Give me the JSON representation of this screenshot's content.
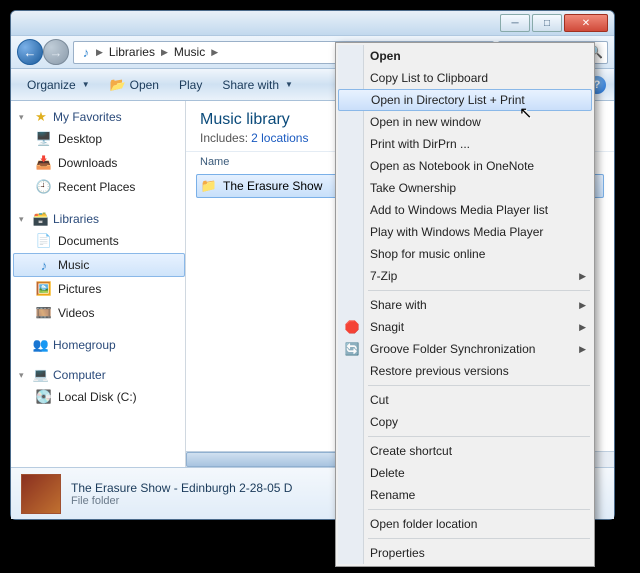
{
  "breadcrumb": {
    "icon": "♪",
    "parts": [
      "Libraries",
      "Music"
    ]
  },
  "toolbar": {
    "organize": "Organize",
    "open": "Open",
    "play": "Play",
    "share": "Share with"
  },
  "sidebar": {
    "favorites": {
      "label": "My Favorites",
      "items": [
        "Desktop",
        "Downloads",
        "Recent Places"
      ]
    },
    "libraries": {
      "label": "Libraries",
      "items": [
        "Documents",
        "Music",
        "Pictures",
        "Videos"
      ],
      "selected": 1
    },
    "homegroup": {
      "label": "Homegroup"
    },
    "computer": {
      "label": "Computer",
      "items": [
        "Local Disk (C:)"
      ]
    }
  },
  "main": {
    "title": "Music library",
    "subtitle_prefix": "Includes:",
    "subtitle_link": "2 locations",
    "col_name": "Name",
    "files": [
      {
        "name": "The Erasure Show",
        "selected": true
      }
    ]
  },
  "details": {
    "title": "The Erasure Show - Edinburgh 2-28-05  D",
    "type": "File folder"
  },
  "context_menu": [
    {
      "label": "Open",
      "bold": true
    },
    {
      "label": "Copy List to Clipboard"
    },
    {
      "label": "Open in Directory List + Print",
      "highlight": true
    },
    {
      "label": "Open in new window"
    },
    {
      "label": "Print with DirPrn ..."
    },
    {
      "label": "Open as Notebook in OneNote"
    },
    {
      "label": "Take Ownership"
    },
    {
      "label": "Add to Windows Media Player list"
    },
    {
      "label": "Play with Windows Media Player"
    },
    {
      "label": "Shop for music online"
    },
    {
      "label": "7-Zip",
      "submenu": true
    },
    {
      "sep": true
    },
    {
      "label": "Share with",
      "submenu": true
    },
    {
      "label": "Snagit",
      "submenu": true,
      "icon": "snagit"
    },
    {
      "label": "Groove Folder Synchronization",
      "submenu": true,
      "icon": "groove"
    },
    {
      "label": "Restore previous versions"
    },
    {
      "sep": true
    },
    {
      "label": "Cut"
    },
    {
      "label": "Copy"
    },
    {
      "sep": true
    },
    {
      "label": "Create shortcut"
    },
    {
      "label": "Delete"
    },
    {
      "label": "Rename"
    },
    {
      "sep": true
    },
    {
      "label": "Open folder location"
    },
    {
      "sep": true
    },
    {
      "label": "Properties"
    }
  ]
}
